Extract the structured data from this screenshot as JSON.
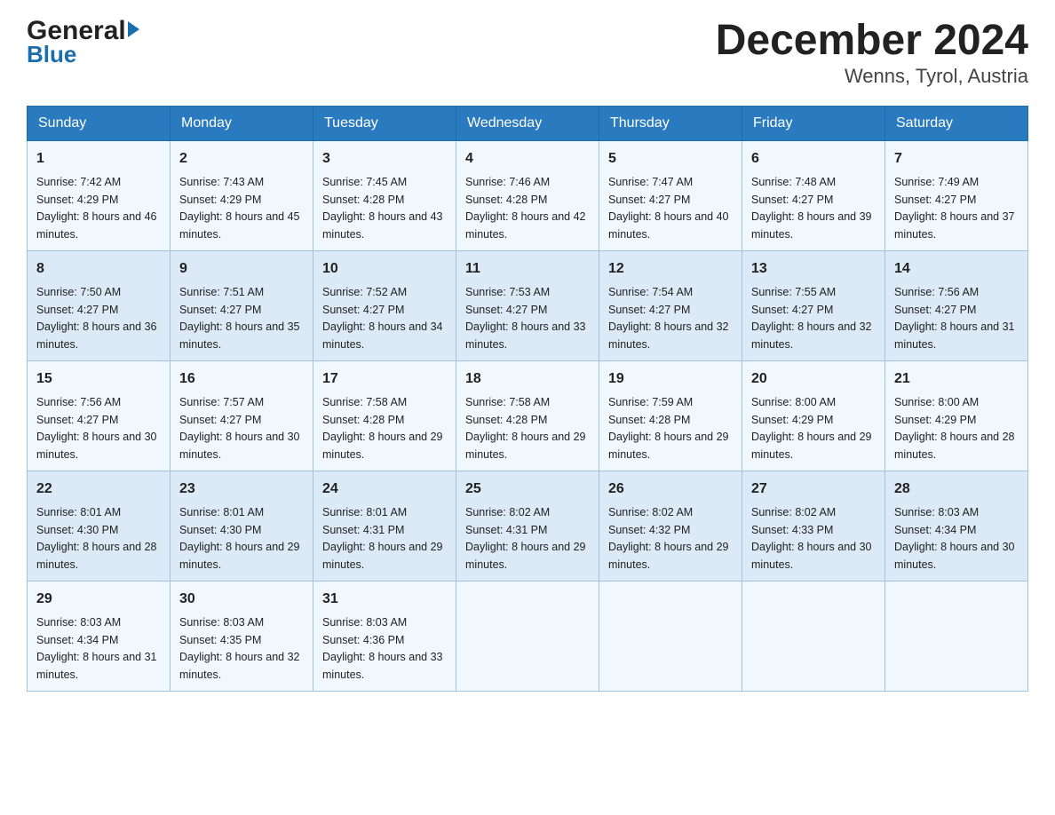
{
  "logo": {
    "general": "General",
    "blue": "Blue",
    "triangle": "▶"
  },
  "title": {
    "month_year": "December 2024",
    "location": "Wenns, Tyrol, Austria"
  },
  "weekdays": [
    "Sunday",
    "Monday",
    "Tuesday",
    "Wednesday",
    "Thursday",
    "Friday",
    "Saturday"
  ],
  "weeks": [
    [
      {
        "day": "1",
        "sunrise": "7:42 AM",
        "sunset": "4:29 PM",
        "daylight": "8 hours and 46 minutes."
      },
      {
        "day": "2",
        "sunrise": "7:43 AM",
        "sunset": "4:29 PM",
        "daylight": "8 hours and 45 minutes."
      },
      {
        "day": "3",
        "sunrise": "7:45 AM",
        "sunset": "4:28 PM",
        "daylight": "8 hours and 43 minutes."
      },
      {
        "day": "4",
        "sunrise": "7:46 AM",
        "sunset": "4:28 PM",
        "daylight": "8 hours and 42 minutes."
      },
      {
        "day": "5",
        "sunrise": "7:47 AM",
        "sunset": "4:27 PM",
        "daylight": "8 hours and 40 minutes."
      },
      {
        "day": "6",
        "sunrise": "7:48 AM",
        "sunset": "4:27 PM",
        "daylight": "8 hours and 39 minutes."
      },
      {
        "day": "7",
        "sunrise": "7:49 AM",
        "sunset": "4:27 PM",
        "daylight": "8 hours and 37 minutes."
      }
    ],
    [
      {
        "day": "8",
        "sunrise": "7:50 AM",
        "sunset": "4:27 PM",
        "daylight": "8 hours and 36 minutes."
      },
      {
        "day": "9",
        "sunrise": "7:51 AM",
        "sunset": "4:27 PM",
        "daylight": "8 hours and 35 minutes."
      },
      {
        "day": "10",
        "sunrise": "7:52 AM",
        "sunset": "4:27 PM",
        "daylight": "8 hours and 34 minutes."
      },
      {
        "day": "11",
        "sunrise": "7:53 AM",
        "sunset": "4:27 PM",
        "daylight": "8 hours and 33 minutes."
      },
      {
        "day": "12",
        "sunrise": "7:54 AM",
        "sunset": "4:27 PM",
        "daylight": "8 hours and 32 minutes."
      },
      {
        "day": "13",
        "sunrise": "7:55 AM",
        "sunset": "4:27 PM",
        "daylight": "8 hours and 32 minutes."
      },
      {
        "day": "14",
        "sunrise": "7:56 AM",
        "sunset": "4:27 PM",
        "daylight": "8 hours and 31 minutes."
      }
    ],
    [
      {
        "day": "15",
        "sunrise": "7:56 AM",
        "sunset": "4:27 PM",
        "daylight": "8 hours and 30 minutes."
      },
      {
        "day": "16",
        "sunrise": "7:57 AM",
        "sunset": "4:27 PM",
        "daylight": "8 hours and 30 minutes."
      },
      {
        "day": "17",
        "sunrise": "7:58 AM",
        "sunset": "4:28 PM",
        "daylight": "8 hours and 29 minutes."
      },
      {
        "day": "18",
        "sunrise": "7:58 AM",
        "sunset": "4:28 PM",
        "daylight": "8 hours and 29 minutes."
      },
      {
        "day": "19",
        "sunrise": "7:59 AM",
        "sunset": "4:28 PM",
        "daylight": "8 hours and 29 minutes."
      },
      {
        "day": "20",
        "sunrise": "8:00 AM",
        "sunset": "4:29 PM",
        "daylight": "8 hours and 29 minutes."
      },
      {
        "day": "21",
        "sunrise": "8:00 AM",
        "sunset": "4:29 PM",
        "daylight": "8 hours and 28 minutes."
      }
    ],
    [
      {
        "day": "22",
        "sunrise": "8:01 AM",
        "sunset": "4:30 PM",
        "daylight": "8 hours and 28 minutes."
      },
      {
        "day": "23",
        "sunrise": "8:01 AM",
        "sunset": "4:30 PM",
        "daylight": "8 hours and 29 minutes."
      },
      {
        "day": "24",
        "sunrise": "8:01 AM",
        "sunset": "4:31 PM",
        "daylight": "8 hours and 29 minutes."
      },
      {
        "day": "25",
        "sunrise": "8:02 AM",
        "sunset": "4:31 PM",
        "daylight": "8 hours and 29 minutes."
      },
      {
        "day": "26",
        "sunrise": "8:02 AM",
        "sunset": "4:32 PM",
        "daylight": "8 hours and 29 minutes."
      },
      {
        "day": "27",
        "sunrise": "8:02 AM",
        "sunset": "4:33 PM",
        "daylight": "8 hours and 30 minutes."
      },
      {
        "day": "28",
        "sunrise": "8:03 AM",
        "sunset": "4:34 PM",
        "daylight": "8 hours and 30 minutes."
      }
    ],
    [
      {
        "day": "29",
        "sunrise": "8:03 AM",
        "sunset": "4:34 PM",
        "daylight": "8 hours and 31 minutes."
      },
      {
        "day": "30",
        "sunrise": "8:03 AM",
        "sunset": "4:35 PM",
        "daylight": "8 hours and 32 minutes."
      },
      {
        "day": "31",
        "sunrise": "8:03 AM",
        "sunset": "4:36 PM",
        "daylight": "8 hours and 33 minutes."
      },
      null,
      null,
      null,
      null
    ]
  ]
}
